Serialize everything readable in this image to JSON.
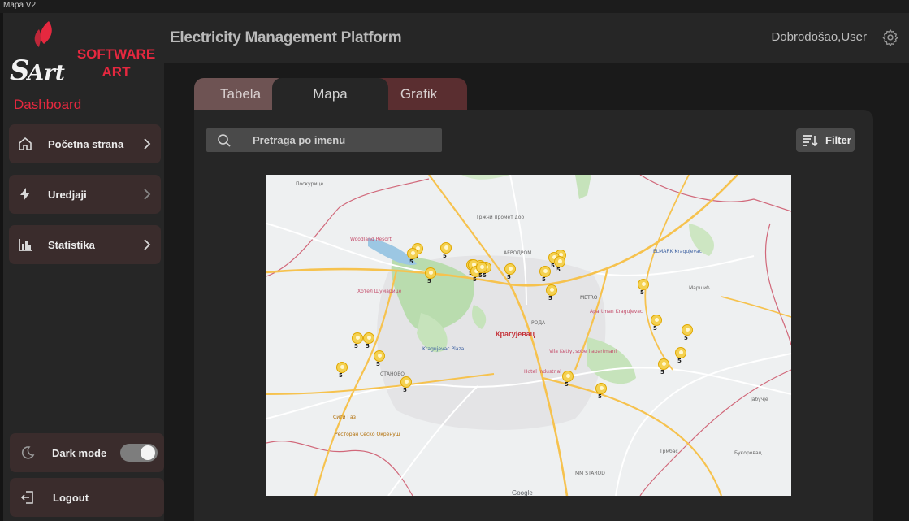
{
  "window": {
    "title": "Mapa V2"
  },
  "brand": {
    "logo_mark": "SArt",
    "name_line1": "SOFTWARE",
    "name_line2": "ART",
    "accent": "#e5283f"
  },
  "sidebar": {
    "heading": "Dashboard",
    "items": [
      {
        "label": "Početna strana",
        "icon": "home-icon"
      },
      {
        "label": "Uredjaji",
        "icon": "lightning-icon"
      },
      {
        "label": "Statistika",
        "icon": "bar-chart-icon"
      }
    ],
    "dark_mode": {
      "label": "Dark mode",
      "enabled": true,
      "icon": "moon-icon"
    },
    "logout": {
      "label": "Logout",
      "icon": "logout-icon"
    }
  },
  "header": {
    "title": "Electricity Management Platform",
    "welcome": "Dobrodošao,User",
    "settings_icon": "gear-icon"
  },
  "tabs": {
    "items": [
      "Tabela",
      "Mapa",
      "Grafik"
    ],
    "active": "Mapa"
  },
  "toolbar": {
    "search_placeholder": "Pretraga po imenu",
    "filter_label": "Filter",
    "search_icon": "search-icon",
    "filter_icon": "sort-filter-icon"
  },
  "map": {
    "city": "Крагујевац",
    "attribution": "Google",
    "marker_label": "5",
    "marker_count": 28,
    "labels": {
      "poskurice": "Поскурице",
      "woodland": "Woodland Resort",
      "trzni": "Тржни промет доо",
      "aerodrom": "АЕРОДРОМ",
      "elmark": "ELMARK Kragujevac",
      "hotel_sumarice": "Хотел Шумарице",
      "hotel_industrial": "Hotel Industrial",
      "stanovo": "СТАНОВО",
      "plaza": "Kragujevac Plaza",
      "marsic": "Маршић",
      "jabucje": "Јабучје",
      "trmbas": "Трмбас",
      "bukorovac": "Букоровац",
      "ms_stado": "MM STAROD",
      "apartman": "Apartman Kragujevac",
      "metro": "METRO",
      "roda": "РОДА",
      "vila_ketty": "Vila Ketty, sobe i apartmani",
      "tesko": "Сити Газ",
      "restoran_sesno": "Ресторан Сеско Окренуш"
    }
  }
}
